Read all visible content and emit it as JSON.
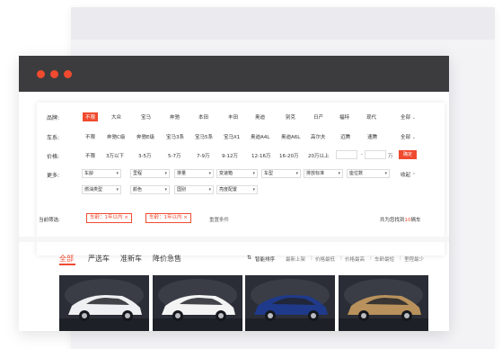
{
  "filters": {
    "brand": {
      "label": "品牌:",
      "options": [
        "不限",
        "大众",
        "宝马",
        "奔驰",
        "本田",
        "丰田",
        "奥迪",
        "别克",
        "日产",
        "福特",
        "现代"
      ],
      "active_index": 0,
      "more": "全部"
    },
    "series": {
      "label": "车系:",
      "options": [
        "不限",
        "奔驰C级",
        "奔驰E级",
        "宝马3系",
        "宝马5系",
        "宝马X1",
        "奥迪A4L",
        "奥迪A6L",
        "高尔夫",
        "迈腾",
        "速腾"
      ],
      "more": "全部"
    },
    "price": {
      "label": "价格:",
      "options": [
        "不限",
        "3万以下",
        "3-5万",
        "5-7万",
        "7-9万",
        "9-12万",
        "12-16万",
        "16-20万",
        "20万以上"
      ],
      "separator": "-",
      "unit": "万",
      "confirm": "确定"
    },
    "more": {
      "label": "更多:",
      "row1": [
        "车龄",
        "里程",
        "排量",
        "变速箱",
        "车型",
        "排放标准",
        "座位数"
      ],
      "row2": [
        "燃油类型",
        "颜色",
        "国别",
        "亮度配置"
      ],
      "collapse": "收起"
    }
  },
  "current": {
    "label": "当前筛选:",
    "chips": [
      "车龄：1年以内 ×",
      "车龄：1年以内 ×"
    ],
    "reset": "重置条件",
    "found_prefix": "共为您找到",
    "found_count": "10",
    "found_suffix": "辆车"
  },
  "tabs": [
    "全部",
    "严选车",
    "准新车",
    "降价急售"
  ],
  "active_tab": 0,
  "sort": {
    "smart": "智能排序",
    "options": [
      "最新上架",
      "价格最低",
      "价格最高",
      "车龄最短",
      "里程最少"
    ]
  },
  "cars": [
    {
      "color": "#eef0f2",
      "bg": "#2b2e36"
    },
    {
      "color": "#f4f4f4",
      "bg": "#2a2d35"
    },
    {
      "color": "#1f3a8a",
      "bg": "#2b2e36"
    },
    {
      "color": "#b8915c",
      "bg": "#2a2d35"
    }
  ],
  "colors": {
    "accent": "#f04a2f",
    "titlebar": "#3c3c3e"
  }
}
